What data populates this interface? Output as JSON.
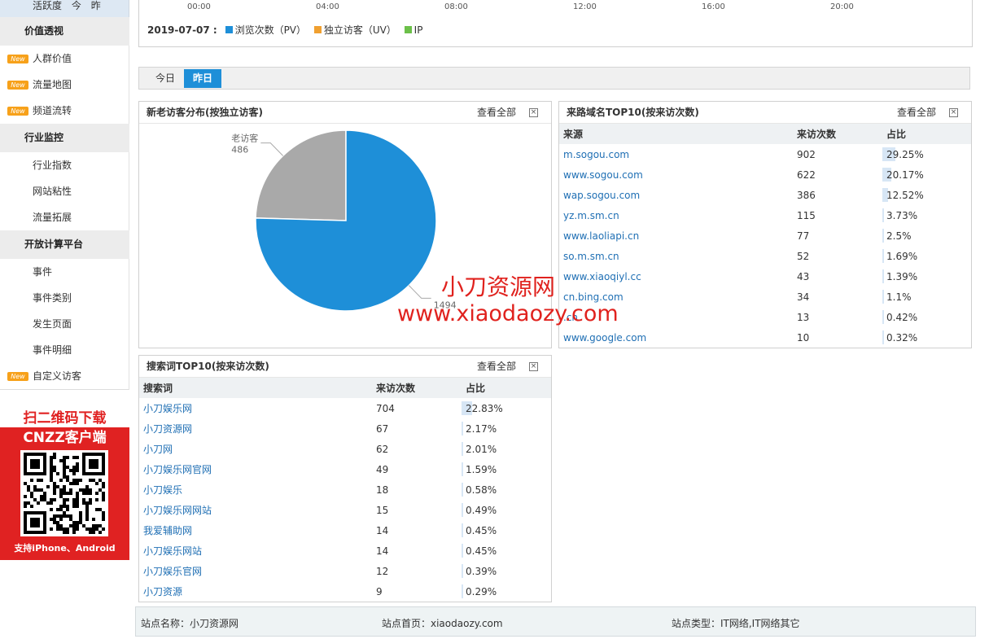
{
  "sidebar": {
    "top_label": "活跃度",
    "top_links": [
      "今",
      "昨"
    ],
    "groups": [
      {
        "title": "价值透视",
        "items": [
          {
            "label": "人群价值",
            "new": true
          },
          {
            "label": "流量地图",
            "new": true
          },
          {
            "label": "频道流转",
            "new": true
          }
        ]
      },
      {
        "title": "行业监控",
        "items": [
          {
            "label": "行业指数",
            "new": false
          },
          {
            "label": "网站粘性",
            "new": false
          },
          {
            "label": "流量拓展",
            "new": false
          }
        ]
      },
      {
        "title": "开放计算平台",
        "items": [
          {
            "label": "事件",
            "new": false
          },
          {
            "label": "事件类别",
            "new": false
          },
          {
            "label": "发生页面",
            "new": false
          },
          {
            "label": "事件明细",
            "new": false
          },
          {
            "label": "自定义访客",
            "new": true
          }
        ]
      }
    ],
    "new_badge": "New",
    "qr": {
      "line1": "扫二维码下载",
      "line2": "CNZZ客户端",
      "support": "支持iPhone、Android"
    }
  },
  "trend": {
    "hours": [
      "00:00",
      "04:00",
      "08:00",
      "12:00",
      "16:00",
      "20:00"
    ],
    "date": "2019-07-07 :",
    "legend": [
      {
        "label": "浏览次数（PV）",
        "color": "#1e8fd8"
      },
      {
        "label": "独立访客（UV）",
        "color": "#f0a030"
      },
      {
        "label": "IP",
        "color": "#6cc04a"
      }
    ]
  },
  "tabs": {
    "today": "今日",
    "yesterday": "昨日",
    "active": "yesterday"
  },
  "visitor_panel": {
    "title": "新老访客分布(按独立访客)",
    "more": "查看全部",
    "close": "×",
    "chart_data": {
      "type": "pie",
      "slices": [
        {
          "label": "老访客",
          "value": 486,
          "color": "#a9a9a9"
        },
        {
          "label": "",
          "value": 1494,
          "color": "#1e8fd8"
        }
      ]
    }
  },
  "referrer_panel": {
    "title": "来路域名TOP10(按来访次数)",
    "more": "查看全部",
    "close": "×",
    "columns": [
      "来源",
      "来访次数",
      "占比"
    ],
    "rows": [
      {
        "name": "m.sogou.com",
        "count": "902",
        "pct": "29.25%",
        "frac": 0.2925
      },
      {
        "name": "www.sogou.com",
        "count": "622",
        "pct": "20.17%",
        "frac": 0.2017
      },
      {
        "name": "wap.sogou.com",
        "count": "386",
        "pct": "12.52%",
        "frac": 0.1252
      },
      {
        "name": "yz.m.sm.cn",
        "count": "115",
        "pct": "3.73%",
        "frac": 0.0373
      },
      {
        "name": "www.laoliapi.cn",
        "count": "77",
        "pct": "2.5%",
        "frac": 0.025
      },
      {
        "name": "so.m.sm.cn",
        "count": "52",
        "pct": "1.69%",
        "frac": 0.0169
      },
      {
        "name": "www.xiaoqiyl.cc",
        "count": "43",
        "pct": "1.39%",
        "frac": 0.0139
      },
      {
        "name": "cn.bing.com",
        "count": "34",
        "pct": "1.1%",
        "frac": 0.011
      },
      {
        "name": ".cn",
        "count": "13",
        "pct": "0.42%",
        "frac": 0.0042
      },
      {
        "name": "www.google.com",
        "count": "10",
        "pct": "0.32%",
        "frac": 0.0032
      }
    ]
  },
  "keyword_panel": {
    "title": "搜索词TOP10(按来访次数)",
    "more": "查看全部",
    "close": "×",
    "columns": [
      "搜索词",
      "来访次数",
      "占比"
    ],
    "rows": [
      {
        "name": "小刀娱乐网",
        "count": "704",
        "pct": "22.83%",
        "frac": 0.2283
      },
      {
        "name": "小刀资源网",
        "count": "67",
        "pct": "2.17%",
        "frac": 0.0217
      },
      {
        "name": "小刀网",
        "count": "62",
        "pct": "2.01%",
        "frac": 0.0201
      },
      {
        "name": "小刀娱乐网官网",
        "count": "49",
        "pct": "1.59%",
        "frac": 0.0159
      },
      {
        "name": "小刀娱乐",
        "count": "18",
        "pct": "0.58%",
        "frac": 0.0058
      },
      {
        "name": "小刀娱乐网网站",
        "count": "15",
        "pct": "0.49%",
        "frac": 0.0049
      },
      {
        "name": "我爱辅助网",
        "count": "14",
        "pct": "0.45%",
        "frac": 0.0045
      },
      {
        "name": "小刀娱乐网站",
        "count": "14",
        "pct": "0.45%",
        "frac": 0.0045
      },
      {
        "name": "小刀娱乐官网",
        "count": "12",
        "pct": "0.39%",
        "frac": 0.0039
      },
      {
        "name": "小刀资源",
        "count": "9",
        "pct": "0.29%",
        "frac": 0.0029
      }
    ]
  },
  "site_info": {
    "name": "站点名称：小刀资源网",
    "home": "站点首页：xiaodaozy.com",
    "type": "站点类型：IT网络,IT网络其它"
  },
  "watermark": {
    "line1": "小刀资源网",
    "line2": "www.xiaodaozy.com"
  }
}
